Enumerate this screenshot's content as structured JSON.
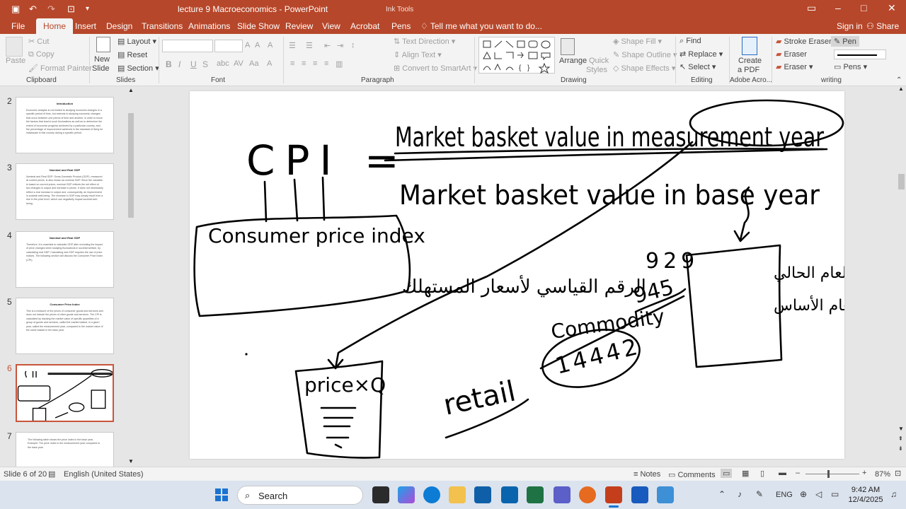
{
  "titlebar": {
    "title": "lecture 9 Macroeconomics - PowerPoint",
    "context": "Ink Tools"
  },
  "tabs": [
    "File",
    "Home",
    "Insert",
    "Design",
    "Transitions",
    "Animations",
    "Slide Show",
    "Review",
    "View",
    "Acrobat",
    "Pens"
  ],
  "active_tab": "Home",
  "tellme": "Tell me what you want to do...",
  "signin": "Sign in",
  "share": "Share",
  "ribbon": {
    "clipboard": {
      "paste": "Paste",
      "cut": "Cut",
      "copy": "Copy",
      "format_painter": "Format Painter",
      "label": "Clipboard"
    },
    "slides": {
      "new_slide_1": "New",
      "new_slide_2": "Slide",
      "layout": "Layout",
      "reset": "Reset",
      "section": "Section",
      "label": "Slides"
    },
    "font": {
      "bold": "B",
      "italic": "I",
      "underline": "U",
      "strike": "S",
      "label": "Font"
    },
    "paragraph": {
      "text_direction": "Text Direction",
      "align_text": "Align Text",
      "smartart": "Convert to SmartArt",
      "label": "Paragraph"
    },
    "drawing": {
      "arrange": "Arrange",
      "quick_1": "Quick",
      "quick_2": "Styles",
      "shape_fill": "Shape Fill",
      "shape_outline": "Shape Outline",
      "shape_effects": "Shape Effects",
      "label": "Drawing"
    },
    "editing": {
      "find": "Find",
      "replace": "Replace",
      "select": "Select",
      "label": "Editing"
    },
    "acrobat": {
      "create_1": "Create",
      "create_2": "a PDF",
      "label": "Adobe Acro..."
    },
    "writing": {
      "stroke_eraser": "Stroke Eraser",
      "pen": "Pen",
      "eraser1": "Eraser",
      "eraser2": "Eraser",
      "pens": "Pens",
      "label": "writing"
    }
  },
  "thumbnails": [
    {
      "num": "2",
      "title": "Introduction",
      "body": "Economic analysis is not limited to studying economic changes in a specific period of time, but extends to studying economic changes that occur between one period of time and another, in order to know the factors that lead to such fluctuations as well as to determine the extent of economic progress achieved by a particular country, and the percentage of improvement achieved in the standard of living for individuals in this country during a specific period."
    },
    {
      "num": "3",
      "title": "Nominal and Real GDP",
      "body": "Nominal and Real GDP: Gross Domestic Product (GDP), measured at current prices, is also known as nominal GDP. Since the valuation is based on current prices, nominal GDP reflects the net effect of two changes in output and increase in prices. It does not necessarily reflect a real increase in output and, consequently, an improvement in societal well-being. The increase in GDP may simply result from a rise in the price level, which can negatively impact societal well-being."
    },
    {
      "num": "4",
      "title": "Nominal and Real GDP",
      "body": "Therefore, it is essential to calculate GDP after excluding the impact of price changes when studying fluctuations in societal welfare, by calculating real GDP. Calculating real GDP requires the use of price indices. The following section will discuss the Consumer Price Index (CPI)."
    },
    {
      "num": "5",
      "title": "Consumer Price Index",
      "body": "This is a measure of the prices of consumer goods and services and does not include the prices of other goods and services. The CPI is calculated by tracking the market value of specific quantities of a group of goods and services, called the market basket, in a given year, called the measurement year, compared to the market value of the same basket in the base year."
    },
    {
      "num": "6",
      "title": "",
      "body": ""
    },
    {
      "num": "7",
      "title": "",
      "body": "The following table shows the price index in the base year. Example: The price index in the measurement year compared to the base year."
    }
  ],
  "slide_ink": {
    "cpi": "CPI =",
    "numerator": "Market basket value in measurement year",
    "denominator": "Market basket value in base year",
    "box_label": "Consumer price index",
    "arabic_box": "الرقم القياسي لأسعار المستهلك",
    "price_box": "price×Q",
    "retail": "retail",
    "commodity": "Commodity",
    "n945": "945",
    "n929": "929",
    "n14442": "14442",
    "arabic_right_1": "العام الحالي",
    "arabic_right_2": "العام الأساس"
  },
  "status": {
    "slide_count": "Slide 6 of 20",
    "language": "English (United States)",
    "notes": "Notes",
    "comments": "Comments",
    "zoom": "87%"
  },
  "taskbar": {
    "search": "Search",
    "lang": "ENG",
    "time": "9:42 AM",
    "date": "12/4/2025"
  },
  "colors": {
    "accent": "#b7472a",
    "ribbon": "#f3f3f3",
    "selected_thumb": "#c8553a"
  }
}
